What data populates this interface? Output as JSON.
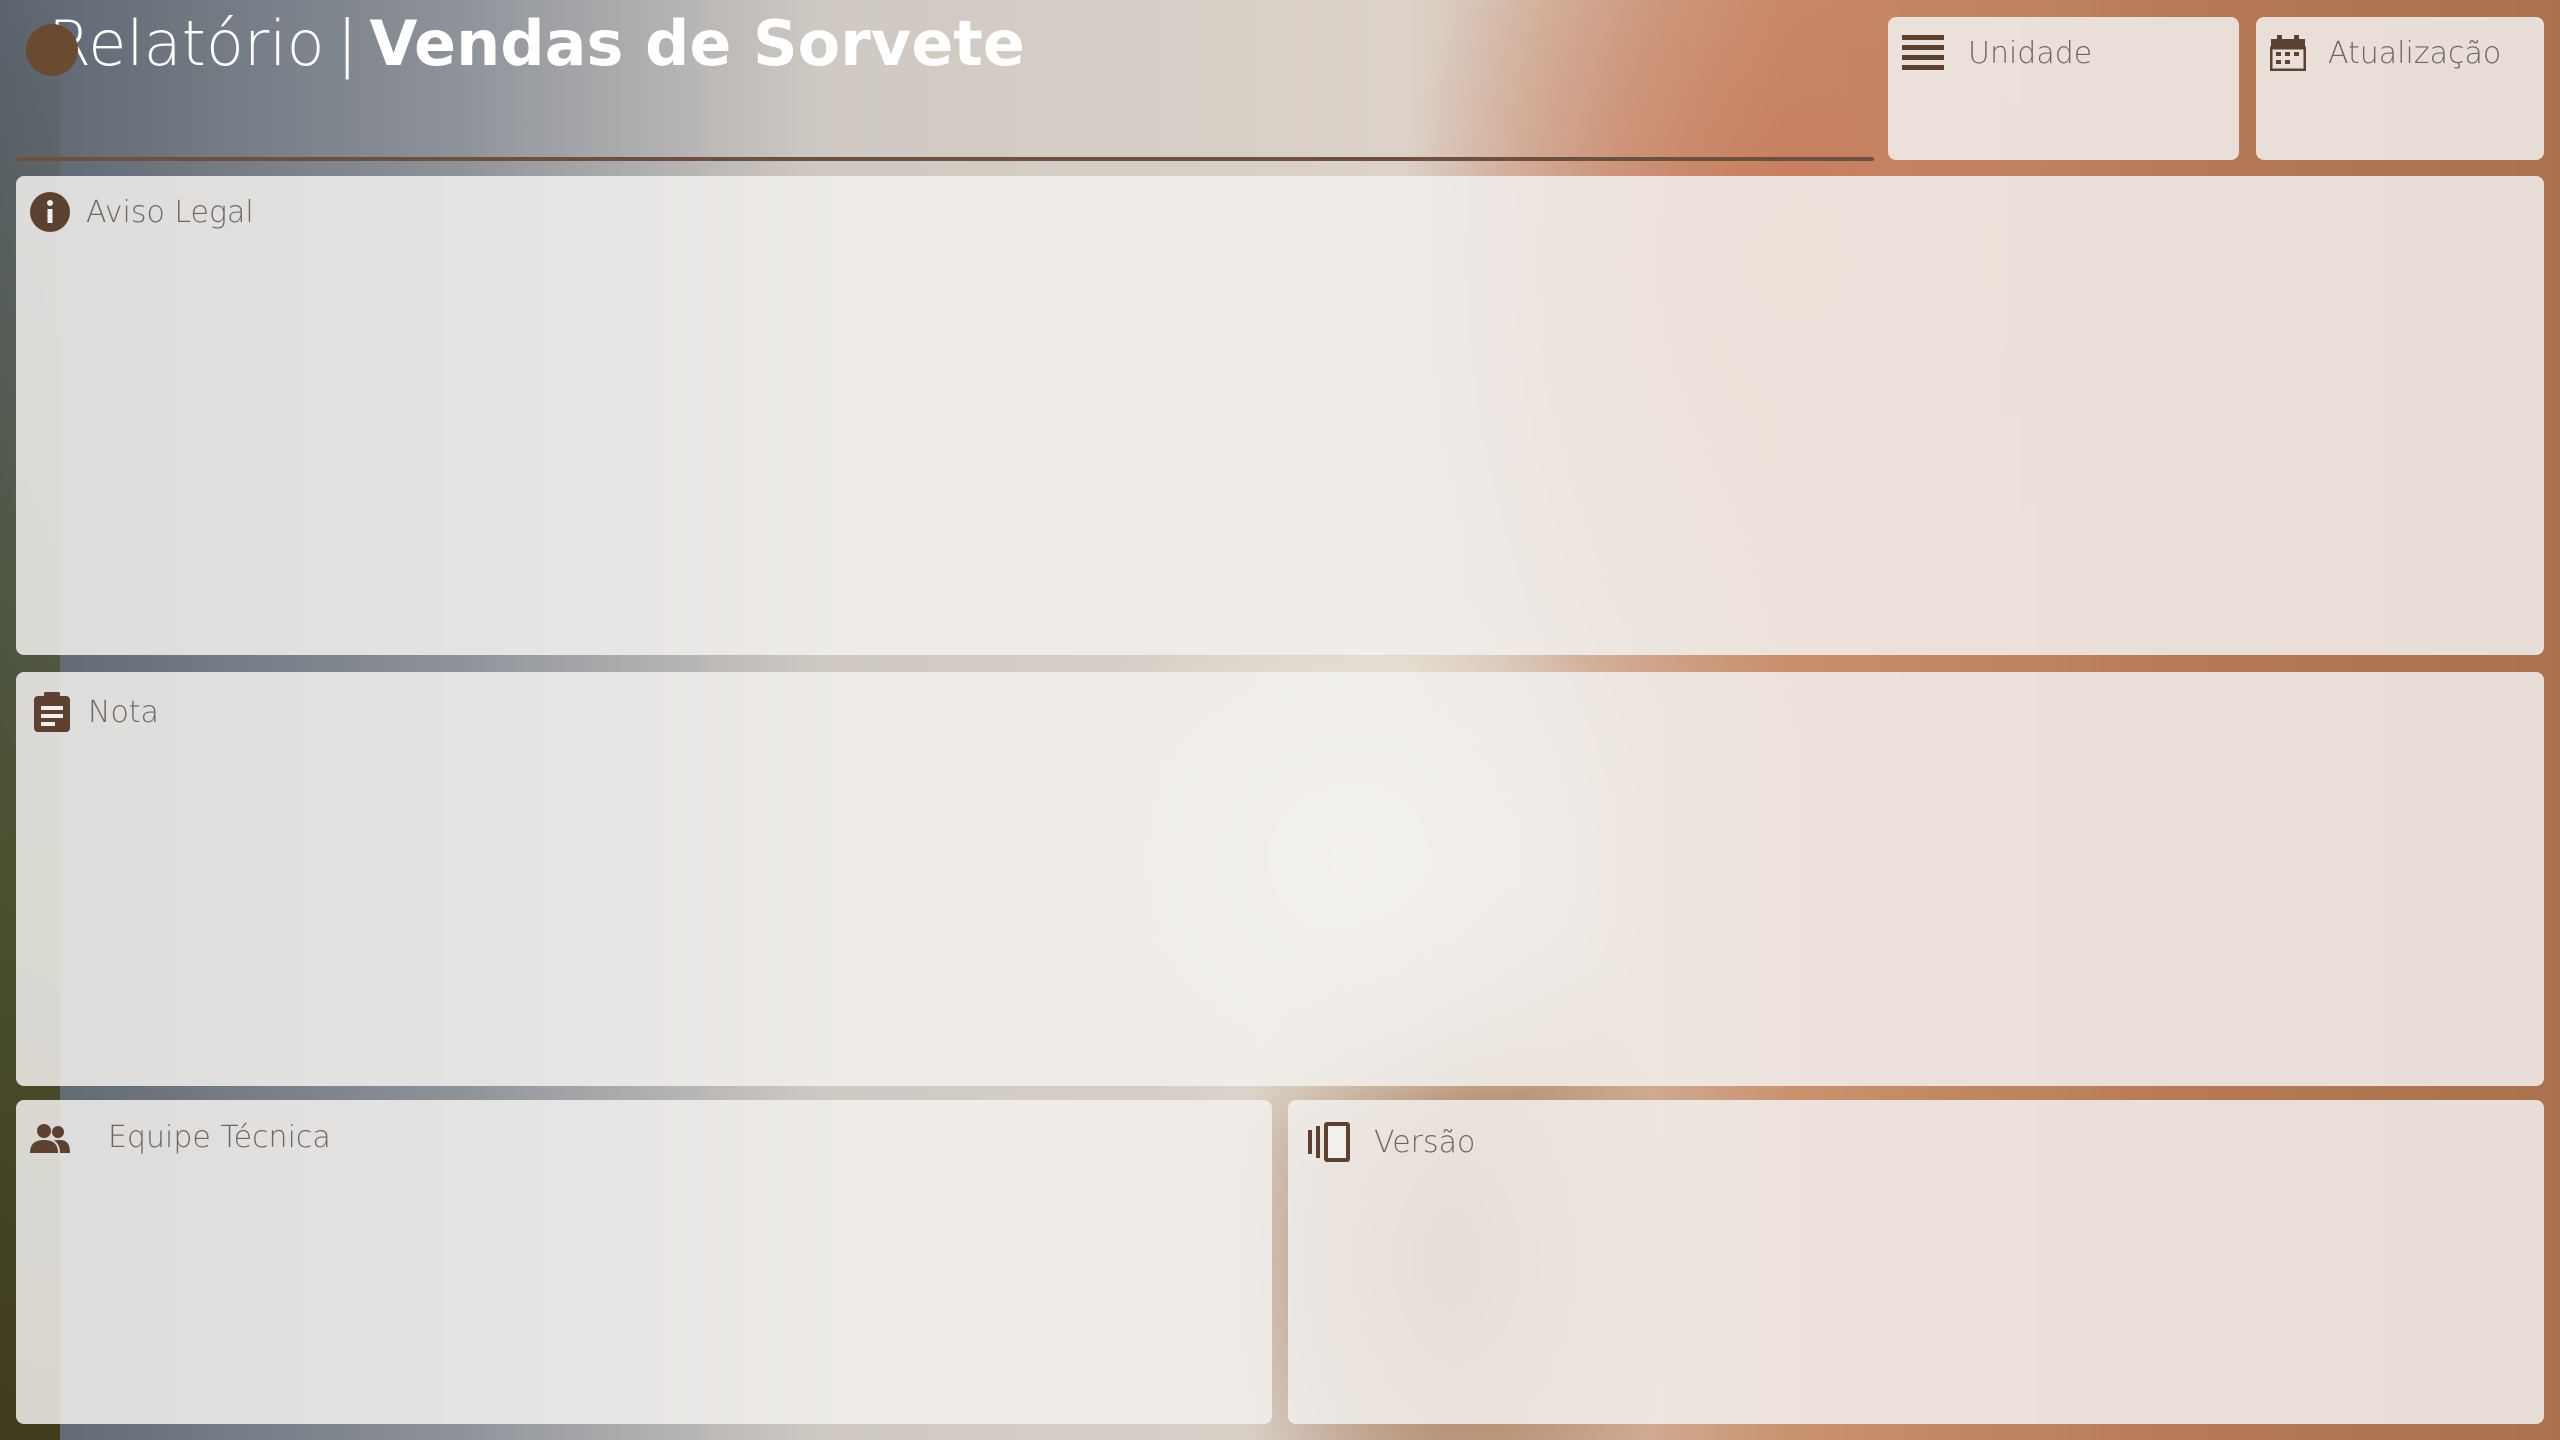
{
  "header": {
    "title_light": "Relatório",
    "title_separator": "|",
    "title_bold": "Vendas de Sorvete"
  },
  "cards": {
    "unidade": {
      "label": "Unidade",
      "icon": "list-icon"
    },
    "atualizacao": {
      "label": "Atualização",
      "icon": "calendar-icon"
    },
    "aviso": {
      "label": "Aviso Legal",
      "icon": "info-icon"
    },
    "nota": {
      "label": "Nota",
      "icon": "note-icon"
    },
    "equipe": {
      "label": "Equipe Técnica",
      "icon": "people-icon"
    },
    "versao": {
      "label": "Versão",
      "icon": "versions-icon"
    }
  },
  "colors": {
    "accent": "#5d4130",
    "card_text": "#6f6660",
    "title_text": "#ffffff"
  }
}
